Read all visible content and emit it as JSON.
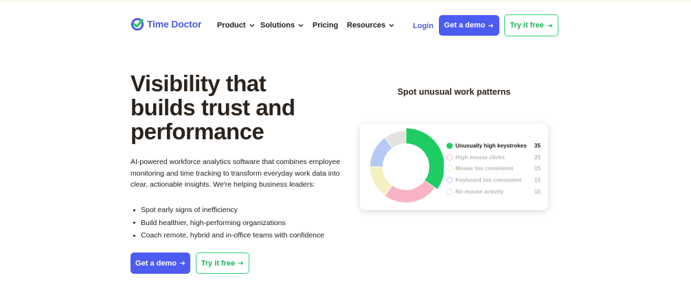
{
  "brand": {
    "name": "Time Doctor",
    "color": "#4a5bdc"
  },
  "nav": {
    "items": [
      {
        "label": "Product",
        "has_dropdown": true
      },
      {
        "label": "Solutions",
        "has_dropdown": true
      },
      {
        "label": "Pricing",
        "has_dropdown": false
      },
      {
        "label": "Resources",
        "has_dropdown": true
      }
    ],
    "login": "Login",
    "demo_button": "Get a demo",
    "try_button": "Try it free"
  },
  "hero": {
    "title": "Visibility that builds trust and performance",
    "description": "AI-powered workforce analytics software that combines employee monitoring and time tracking to transform everyday work data into clear, actionable insights. We're helping business leaders:",
    "bullets": [
      "Spot early signs of inefficiency",
      "Build healthier, high-performing organizations",
      "Coach remote, hybrid and in-office teams with confidence"
    ],
    "demo_button": "Get a demo",
    "try_button": "Try it free"
  },
  "visual": {
    "title": "Spot unusual work patterns",
    "legend": [
      {
        "label": "Unusually high keystrokes",
        "value": "35",
        "color": "#1fcc64",
        "active": true
      },
      {
        "label": "High mouse clicks",
        "value": "25",
        "color": "#f8b4c4",
        "active": false
      },
      {
        "label": "Mouse too consistent",
        "value": "15",
        "color": "#f5f0c2",
        "active": false
      },
      {
        "label": "Keyboard too consistent",
        "value": "15",
        "color": "#b6c9f5",
        "active": false
      },
      {
        "label": "No mouse activity",
        "value": "10",
        "color": "#e3e3e0",
        "active": false
      }
    ]
  },
  "colors": {
    "primary_button": "#4c5cf0",
    "accent_green": "#2bd47a",
    "text_dark": "#2b231d"
  },
  "icons": {
    "logo": "checkmark-clock-icon",
    "dropdown": "chevron-down-icon",
    "arrow": "arrow-right-icon"
  }
}
